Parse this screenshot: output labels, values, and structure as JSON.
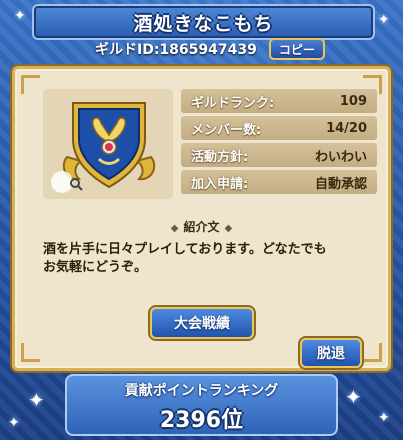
{
  "guild": {
    "name": "酒処きなこもち",
    "id_text": "ギルドID:1865947439",
    "copy_label": "コピー"
  },
  "emblem": {
    "icon": "shield-crest-icon",
    "zoom_icon": "zoom-icon"
  },
  "stats": [
    {
      "label": "ギルドランク:",
      "value": "109"
    },
    {
      "label": "メンバー数:",
      "value": "14/20"
    },
    {
      "label": "活動方針:",
      "value": "わいわい"
    },
    {
      "label": "加入申請:",
      "value": "自動承認"
    }
  ],
  "intro": {
    "heading": "紹介文",
    "line1": "酒を片手に日々プレイしております。どなたでも",
    "line2": "お気軽にどうぞ。"
  },
  "buttons": {
    "tournament": "大会戦績",
    "leave": "脱退"
  },
  "ranking": {
    "title": "貢献ポイントランキング",
    "value": "2396位"
  },
  "colors": {
    "background": "#2b62b4",
    "panel": "#efe4cc",
    "gold_border": "#d6b15a",
    "button_blue": "#2054ac"
  }
}
